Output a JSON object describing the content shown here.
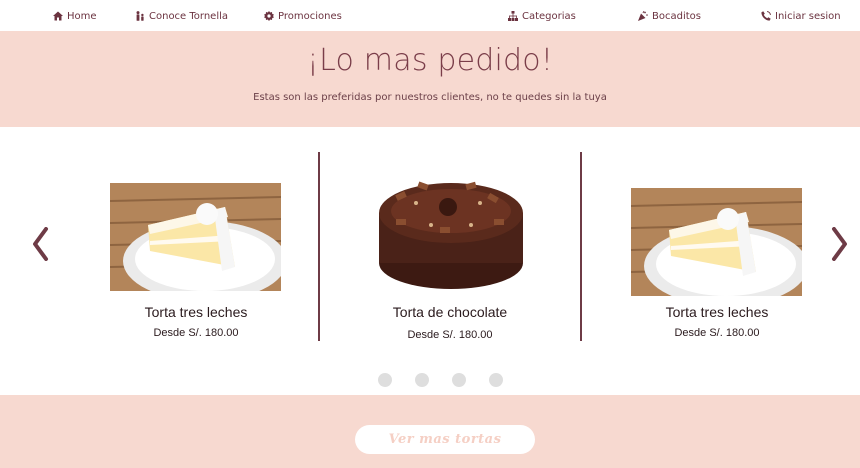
{
  "nav": {
    "home": "Home",
    "conoce": "Conoce Tornella",
    "promociones": "Promociones",
    "categorias": "Categorias",
    "bocaditos": "Bocaditos",
    "login": "Iniciar sesion"
  },
  "hero": {
    "title": "¡Lo mas pedido!",
    "subtitle": "Estas son las preferidas por nuestros clientes, no te quedes sin la tuya"
  },
  "carousel": {
    "items": [
      {
        "name": "Torta tres leches",
        "price": "Desde S/. 180.00",
        "image": "tres-leches-slice"
      },
      {
        "name": "Torta de chocolate",
        "price": "Desde S/. 180.00",
        "image": "chocolate-cake"
      },
      {
        "name": "Torta tres leches",
        "price": "Desde S/. 180.00",
        "image": "tres-leches-slice"
      }
    ],
    "dots": 4
  },
  "cta": {
    "label": "Ver mas tortas"
  },
  "colors": {
    "accent": "#6e3b46",
    "band": "#f7d9d0",
    "cta_text": "#f5cfc4"
  }
}
